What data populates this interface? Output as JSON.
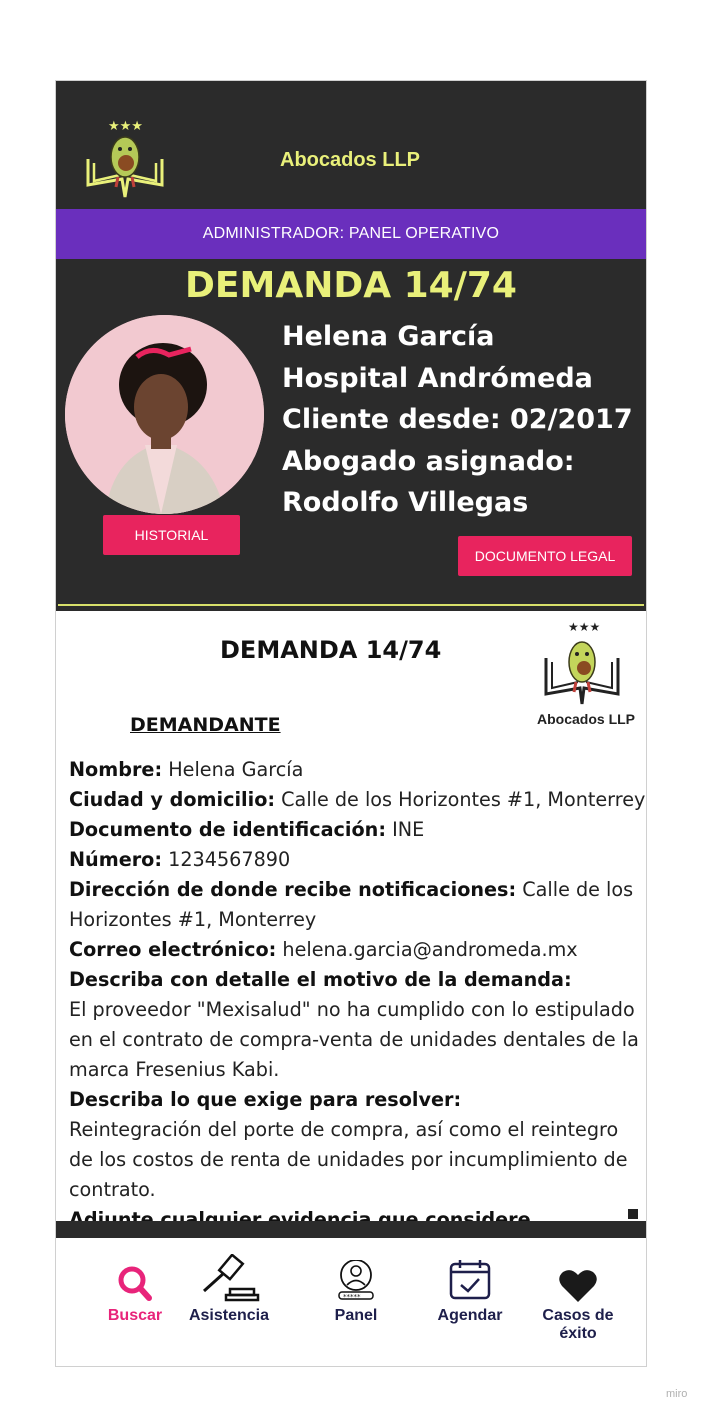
{
  "app": {
    "brand": "Abocados LLP",
    "admin_bar": "ADMINISTRADOR: PANEL OPERATIVO"
  },
  "case": {
    "title": "DEMANDA 14/74"
  },
  "client": {
    "name": "Helena García",
    "hospital": "Hospital Andrómeda",
    "since": "Cliente desde: 02/2017",
    "lawyer_label": "Abogado asignado:",
    "lawyer_name": "Rodolfo Villegas"
  },
  "buttons": {
    "history": "HISTORIAL",
    "legal_document": "DOCUMENTO LEGAL"
  },
  "document": {
    "title": "DEMANDA 14/74",
    "brand": "Abocados LLP",
    "section": "DEMANDANTE",
    "fields": {
      "name_label": "Nombre:",
      "name_value": " Helena García",
      "city_label": "Ciudad y domicilio:",
      "city_value": " Calle de los Horizontes #1, Monterrey",
      "id_label": "Documento de identificación:",
      "id_value": " INE",
      "number_label": "Número:",
      "number_value": " 1234567890",
      "notify_label": "Dirección de donde recibe notificaciones:",
      "notify_value": " Calle de los Horizontes #1, Monterrey",
      "email_label": "Correo electrónico:",
      "email_value": " helena.garcia@andromeda.mx",
      "reason_label": "Describa con detalle el motivo de la demanda:",
      "reason_value": "El proveedor \"Mexisalud\" no ha cumplido con lo estipulado en el contrato de compra-venta de unidades dentales de la marca Fresenius Kabi.",
      "demand_label": "Describa lo que exige para resolver:",
      "demand_value": "Reintegración del porte de compra, así como el reintegro de los costos de renta de unidades por incumplimiento de contrato.",
      "evidence_label": "Adjunte cualquier evidencia que considere importante:"
    }
  },
  "nav": [
    {
      "label": "Buscar",
      "icon": "search-icon",
      "active": true
    },
    {
      "label": "Asistencia",
      "icon": "gavel-icon",
      "active": false
    },
    {
      "label": "Panel",
      "icon": "user-panel-icon",
      "active": false
    },
    {
      "label": "Agendar",
      "icon": "calendar-check-icon",
      "active": false
    },
    {
      "label": "Casos de éxito",
      "icon": "heart-icon",
      "active": false
    }
  ],
  "colors": {
    "dark_bg": "#2b2b2b",
    "brand_yellow": "#e9f07a",
    "admin_purple": "#6a2fbd",
    "button_pink": "#e8245e",
    "nav_text": "#1e1f4b"
  },
  "watermark": "miro"
}
